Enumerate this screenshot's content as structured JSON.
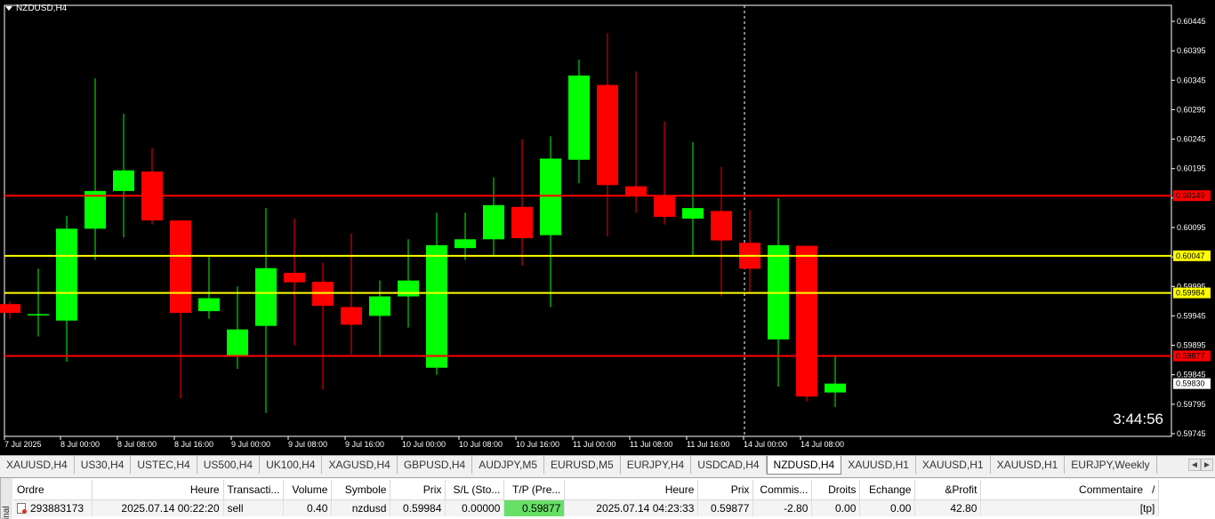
{
  "chart": {
    "title": "NZDUSD,H4",
    "countdown": "3:44:56",
    "price_axis": {
      "min": 0.59745,
      "max": 0.60445,
      "ticks": [
        "0.60445",
        "0.60395",
        "0.60345",
        "0.60295",
        "0.60245",
        "0.60195",
        "0.60145",
        "0.60095",
        "0.60045",
        "0.59995",
        "0.59945",
        "0.59895",
        "0.59845",
        "0.59795",
        "0.59745"
      ]
    },
    "time_axis": {
      "labels": [
        "7 Jul 2025",
        "8 Jul 00:00",
        "8 Jul 08:00",
        "8 Jul 16:00",
        "9 Jul 00:00",
        "9 Jul 08:00",
        "9 Jul 16:00",
        "10 Jul 00:00",
        "10 Jul 08:00",
        "10 Jul 16:00",
        "11 Jul 00:00",
        "11 Jul 08:00",
        "11 Jul 16:00",
        "14 Jul 00:00",
        "14 Jul 08:00"
      ]
    },
    "levels": [
      {
        "price": 0.60149,
        "label": "0.60149",
        "color": "#ff0000"
      },
      {
        "price": 0.60047,
        "label": "0.60047",
        "color": "#ffff00"
      },
      {
        "price": 0.59984,
        "label": "0.59984",
        "color": "#ffff00"
      },
      {
        "price": 0.59877,
        "label": "0.59877",
        "color": "#ff0000"
      }
    ],
    "current_price": "0.59830",
    "colors": {
      "bull": "#00ff00",
      "bear": "#ff0000",
      "background": "#000000",
      "foreground": "#ffffff"
    }
  },
  "chart_data": {
    "type": "candlestick",
    "title": "NZDUSD,H4",
    "series": [
      {
        "name": "NZDUSD",
        "candles": [
          {
            "o": 0.59965,
            "h": 0.5997,
            "l": 0.5994,
            "c": 0.5995
          },
          {
            "o": 0.59948,
            "h": 0.60025,
            "l": 0.5991,
            "c": 0.59948
          },
          {
            "o": 0.59937,
            "h": 0.60115,
            "l": 0.59867,
            "c": 0.60093
          },
          {
            "o": 0.60093,
            "h": 0.60348,
            "l": 0.6004,
            "c": 0.60157
          },
          {
            "o": 0.60157,
            "h": 0.60288,
            "l": 0.60078,
            "c": 0.60192
          },
          {
            "o": 0.6019,
            "h": 0.6023,
            "l": 0.601,
            "c": 0.60107
          },
          {
            "o": 0.60107,
            "h": 0.5996,
            "l": 0.59805,
            "c": 0.5995
          },
          {
            "o": 0.59953,
            "h": 0.60045,
            "l": 0.5994,
            "c": 0.59975
          },
          {
            "o": 0.59878,
            "h": 0.59995,
            "l": 0.59855,
            "c": 0.59922
          },
          {
            "o": 0.59928,
            "h": 0.60128,
            "l": 0.5978,
            "c": 0.60026
          },
          {
            "o": 0.60018,
            "h": 0.6011,
            "l": 0.59895,
            "c": 0.60002
          },
          {
            "o": 0.60003,
            "h": 0.60035,
            "l": 0.5982,
            "c": 0.59962
          },
          {
            "o": 0.5996,
            "h": 0.60085,
            "l": 0.5988,
            "c": 0.5993
          },
          {
            "o": 0.59945,
            "h": 0.60005,
            "l": 0.59875,
            "c": 0.59978
          },
          {
            "o": 0.59978,
            "h": 0.60075,
            "l": 0.59925,
            "c": 0.60005
          },
          {
            "o": 0.59857,
            "h": 0.6012,
            "l": 0.59845,
            "c": 0.60065
          },
          {
            "o": 0.6006,
            "h": 0.6012,
            "l": 0.6004,
            "c": 0.60075
          },
          {
            "o": 0.60075,
            "h": 0.6018,
            "l": 0.60045,
            "c": 0.60133
          },
          {
            "o": 0.6013,
            "h": 0.60245,
            "l": 0.6003,
            "c": 0.60077
          },
          {
            "o": 0.60082,
            "h": 0.6025,
            "l": 0.5996,
            "c": 0.60212
          },
          {
            "o": 0.6021,
            "h": 0.6038,
            "l": 0.6017,
            "c": 0.60353
          },
          {
            "o": 0.60337,
            "h": 0.60425,
            "l": 0.6008,
            "c": 0.60167
          },
          {
            "o": 0.60165,
            "h": 0.6036,
            "l": 0.6012,
            "c": 0.6015
          },
          {
            "o": 0.6015,
            "h": 0.60275,
            "l": 0.601,
            "c": 0.60113
          },
          {
            "o": 0.6011,
            "h": 0.6024,
            "l": 0.60045,
            "c": 0.60128
          },
          {
            "o": 0.60123,
            "h": 0.60198,
            "l": 0.59978,
            "c": 0.60073
          },
          {
            "o": 0.60069,
            "h": 0.60125,
            "l": 0.59985,
            "c": 0.60025
          },
          {
            "o": 0.59905,
            "h": 0.60145,
            "l": 0.59825,
            "c": 0.60065
          },
          {
            "o": 0.60064,
            "h": 0.59985,
            "l": 0.598,
            "c": 0.59808
          },
          {
            "o": 0.59815,
            "h": 0.59876,
            "l": 0.5979,
            "c": 0.5983
          }
        ]
      }
    ],
    "ylim": [
      0.59745,
      0.60445
    ],
    "grid": false
  },
  "tabs": {
    "items": [
      "XAUUSD,H4",
      "US30,H4",
      "USTEC,H4",
      "US500,H4",
      "UK100,H4",
      "XAGUSD,H4",
      "GBPUSD,H4",
      "AUDJPY,M5",
      "EURUSD,M5",
      "EURJPY,H4",
      "USDCAD,H4",
      "NZDUSD,H4",
      "XAUUSD,H1",
      "XAUUSD,H1",
      "XAUUSD,H1",
      "EURJPY,Weekly"
    ],
    "active_index": 11,
    "scroll_left": "◄",
    "scroll_right": "►"
  },
  "terminal": {
    "side_label": "inal",
    "columns": [
      "Ordre",
      "Heure",
      "Transacti...",
      "Volume",
      "Symbole",
      "Prix",
      "S/L (Sto...",
      "T/P (Pre...",
      "Heure",
      "Prix",
      "Commis...",
      "Droits",
      "Echange",
      "&Profit",
      "Commentaire"
    ],
    "sort_indicator": "/",
    "rows": [
      [
        "293883173",
        "2025.07.14 00:22:20",
        "sell",
        "0.40",
        "nzdusd",
        "0.59984",
        "0.00000",
        "0.59877",
        "2025.07.14 04:23:33",
        "0.59877",
        "-2.80",
        "0.00",
        "0.00",
        "42.80",
        "[tp]"
      ]
    ]
  }
}
